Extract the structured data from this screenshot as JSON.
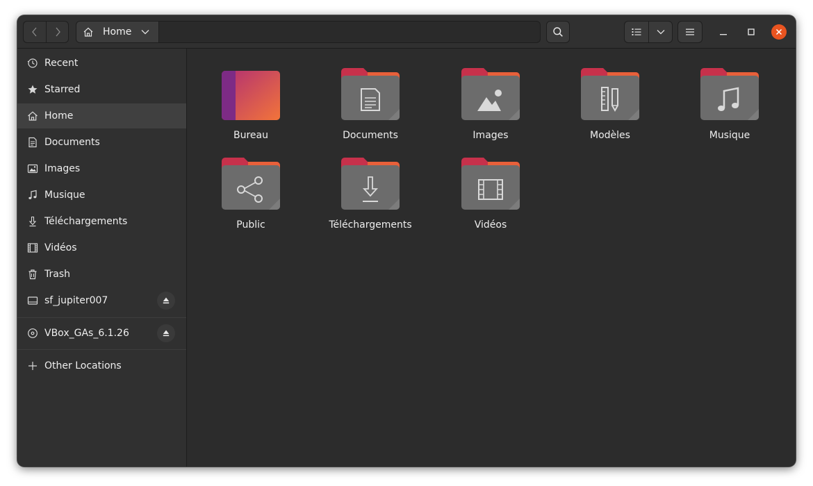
{
  "headerbar": {
    "back_icon": "chevron-left-icon",
    "forward_icon": "chevron-right-icon",
    "path_home_label": "Home",
    "search_icon": "search-icon",
    "list_view_icon": "list-view-icon",
    "view_options_icon": "chevron-down-icon",
    "main_menu_icon": "hamburger-menu-icon",
    "window_controls": [
      "minimize",
      "maximize",
      "close"
    ]
  },
  "colors": {
    "accent": "#e95420",
    "folder_tab": "#c7314b",
    "folder_body": "#6a6a6a",
    "desktop_gradient": [
      "#7a2a82",
      "#f0733a"
    ]
  },
  "sidebar": {
    "items": [
      {
        "label": "Recent",
        "icon": "clock-icon"
      },
      {
        "label": "Starred",
        "icon": "star-icon"
      },
      {
        "label": "Home",
        "icon": "home-icon",
        "active": true
      },
      {
        "label": "Documents",
        "icon": "document-icon"
      },
      {
        "label": "Images",
        "icon": "image-icon"
      },
      {
        "label": "Musique",
        "icon": "music-note-icon"
      },
      {
        "label": "Téléchargements",
        "icon": "download-icon"
      },
      {
        "label": "Vidéos",
        "icon": "film-icon"
      },
      {
        "label": "Trash",
        "icon": "trash-icon"
      }
    ],
    "devices": [
      {
        "label": "sf_jupiter007",
        "icon": "drive-icon",
        "eject_icon": "eject-icon"
      },
      {
        "label": "VBox_GAs_6.1.26",
        "icon": "disc-icon",
        "eject_icon": "eject-icon"
      }
    ],
    "other_locations": {
      "label": "Other Locations",
      "icon": "plus-icon"
    }
  },
  "files": [
    {
      "name": "Bureau",
      "icon": "desktop-folder-icon"
    },
    {
      "name": "Documents",
      "icon": "documents-folder-icon"
    },
    {
      "name": "Images",
      "icon": "pictures-folder-icon"
    },
    {
      "name": "Modèles",
      "icon": "templates-folder-icon"
    },
    {
      "name": "Musique",
      "icon": "music-folder-icon"
    },
    {
      "name": "Public",
      "icon": "public-folder-icon"
    },
    {
      "name": "Téléchargements",
      "icon": "downloads-folder-icon"
    },
    {
      "name": "Vidéos",
      "icon": "videos-folder-icon"
    }
  ]
}
